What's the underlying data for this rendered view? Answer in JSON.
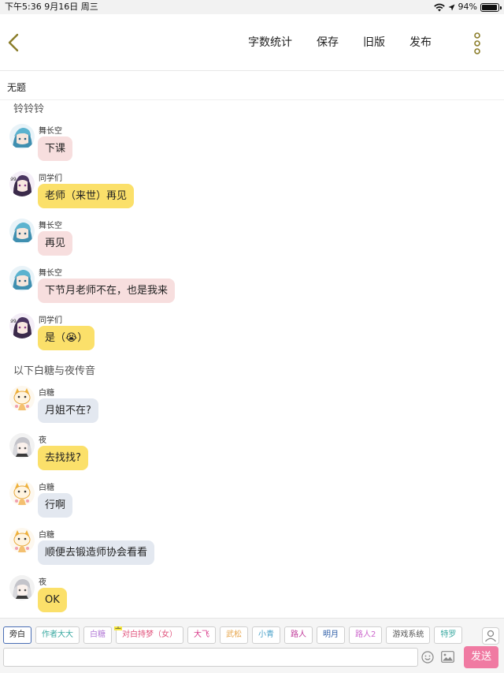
{
  "status_bar": {
    "time_date": "下午5:36   9月16日 周三",
    "battery_text": "94%",
    "battery_level": 0.94
  },
  "header": {
    "back_icon": "chevron-left-icon",
    "actions": [
      "字数统计",
      "保存",
      "旧版",
      "发布"
    ],
    "more_icon": "more-vertical-icon"
  },
  "document": {
    "title": "无题"
  },
  "chat": {
    "narration_1": "铃铃铃",
    "narration_2": "以下白糖与夜传音",
    "messages": [
      {
        "sender": "舞长空",
        "text": "下课",
        "avatar": "blue-hair-avatar",
        "bubble_color": "#f7dede"
      },
      {
        "sender": "同学们",
        "text": "老师（来世）再见",
        "avatar": "purple-hair-avatar",
        "bubble_color": "#fbe06a"
      },
      {
        "sender": "舞长空",
        "text": "再见",
        "avatar": "blue-hair-avatar",
        "bubble_color": "#f7dede"
      },
      {
        "sender": "舞长空",
        "text": "下节月老师不在，也是我来",
        "avatar": "blue-hair-avatar",
        "bubble_color": "#f7dede"
      },
      {
        "sender": "同学们",
        "text": "是（😭）",
        "avatar": "purple-hair-avatar",
        "bubble_color": "#fbe06a"
      },
      {
        "sender": "白糖",
        "text": "月姐不在?",
        "avatar": "cat-avatar",
        "bubble_color": "#e3e8f0"
      },
      {
        "sender": "夜",
        "text": "去找找?",
        "avatar": "white-hair-avatar",
        "bubble_color": "#fbe06a"
      },
      {
        "sender": "白糖",
        "text": "行啊",
        "avatar": "cat-avatar",
        "bubble_color": "#e3e8f0"
      },
      {
        "sender": "白糖",
        "text": "顺便去锻造师协会看看",
        "avatar": "cat-avatar",
        "bubble_color": "#e3e8f0"
      },
      {
        "sender": "夜",
        "text": "OK",
        "avatar": "white-hair-avatar",
        "bubble_color": "#fbe06a"
      }
    ]
  },
  "toolbar": {
    "host_mark": "主",
    "characters": [
      {
        "label": "旁白",
        "color": "#222222",
        "active": true
      },
      {
        "label": "作者大大",
        "color": "#3aa9a1"
      },
      {
        "label": "白糖",
        "color": "#b27ad6"
      },
      {
        "label": "对白持梦（女）",
        "color": "#e0507a",
        "host": true
      },
      {
        "label": "大飞",
        "color": "#d83a8a"
      },
      {
        "label": "武松",
        "color": "#e7a54a"
      },
      {
        "label": "小青",
        "color": "#4aa0c8"
      },
      {
        "label": "路人",
        "color": "#c03a9a"
      },
      {
        "label": "明月",
        "color": "#2f5fa8"
      },
      {
        "label": "路人2",
        "color": "#cc66cc"
      },
      {
        "label": "游戏系统",
        "color": "#555555"
      },
      {
        "label": "特罗",
        "color": "#3aa9a1"
      }
    ],
    "person_icon": "person-icon",
    "input_value": "",
    "input_placeholder": "",
    "emoji_icon": "emoji-icon",
    "image_icon": "image-icon",
    "send_label": "发送",
    "send_color": "#f07aa2"
  }
}
